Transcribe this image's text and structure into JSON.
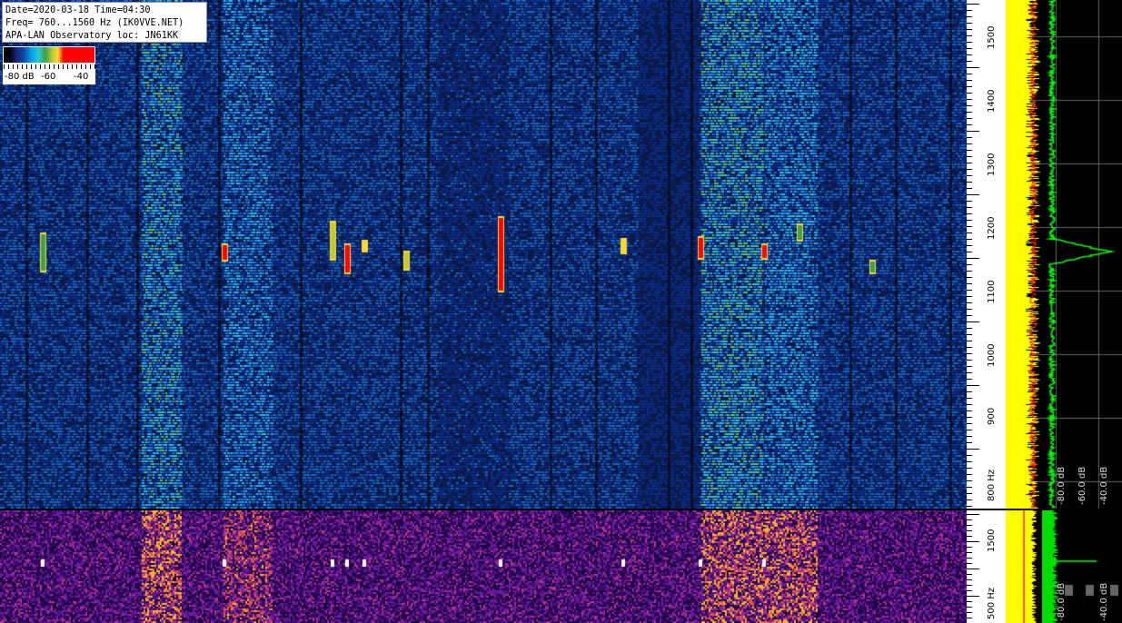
{
  "info": {
    "line1": "Date=2020-03-18 Time=04:30",
    "line2": "Freq= 760...1560 Hz (IK0VVE.NET)",
    "line3": "APA-LAN Observatory loc: JN61KK"
  },
  "colorbar": {
    "labels": [
      "-80 dB",
      "-60",
      "-40"
    ]
  },
  "freq_axis": {
    "main_labels": [
      "1500",
      "1400",
      "1300",
      "1200",
      "1100",
      "1000",
      "900",
      "800 Hz"
    ],
    "bottom_labels": [
      "1500",
      "500 Hz"
    ]
  },
  "spectrum": {
    "main_db_labels": [
      "-80.0 dB",
      "-60.0 dB",
      "-40.0 dB"
    ],
    "bottom_db_labels": [
      "-80.0 dB",
      "-40.0 dB"
    ]
  },
  "colors": {
    "background": "#000000",
    "waterfall_noise": "#1565c0",
    "signal": "#ff0000",
    "spectrum_fill": "#ffff00",
    "spectrum_line": "#00ff00"
  },
  "chart_data": {
    "type": "heatmap",
    "x_unit": "time",
    "y_unit": "Hz",
    "ylim": [
      760,
      1560
    ],
    "signal_freq_hz": 1160
  }
}
